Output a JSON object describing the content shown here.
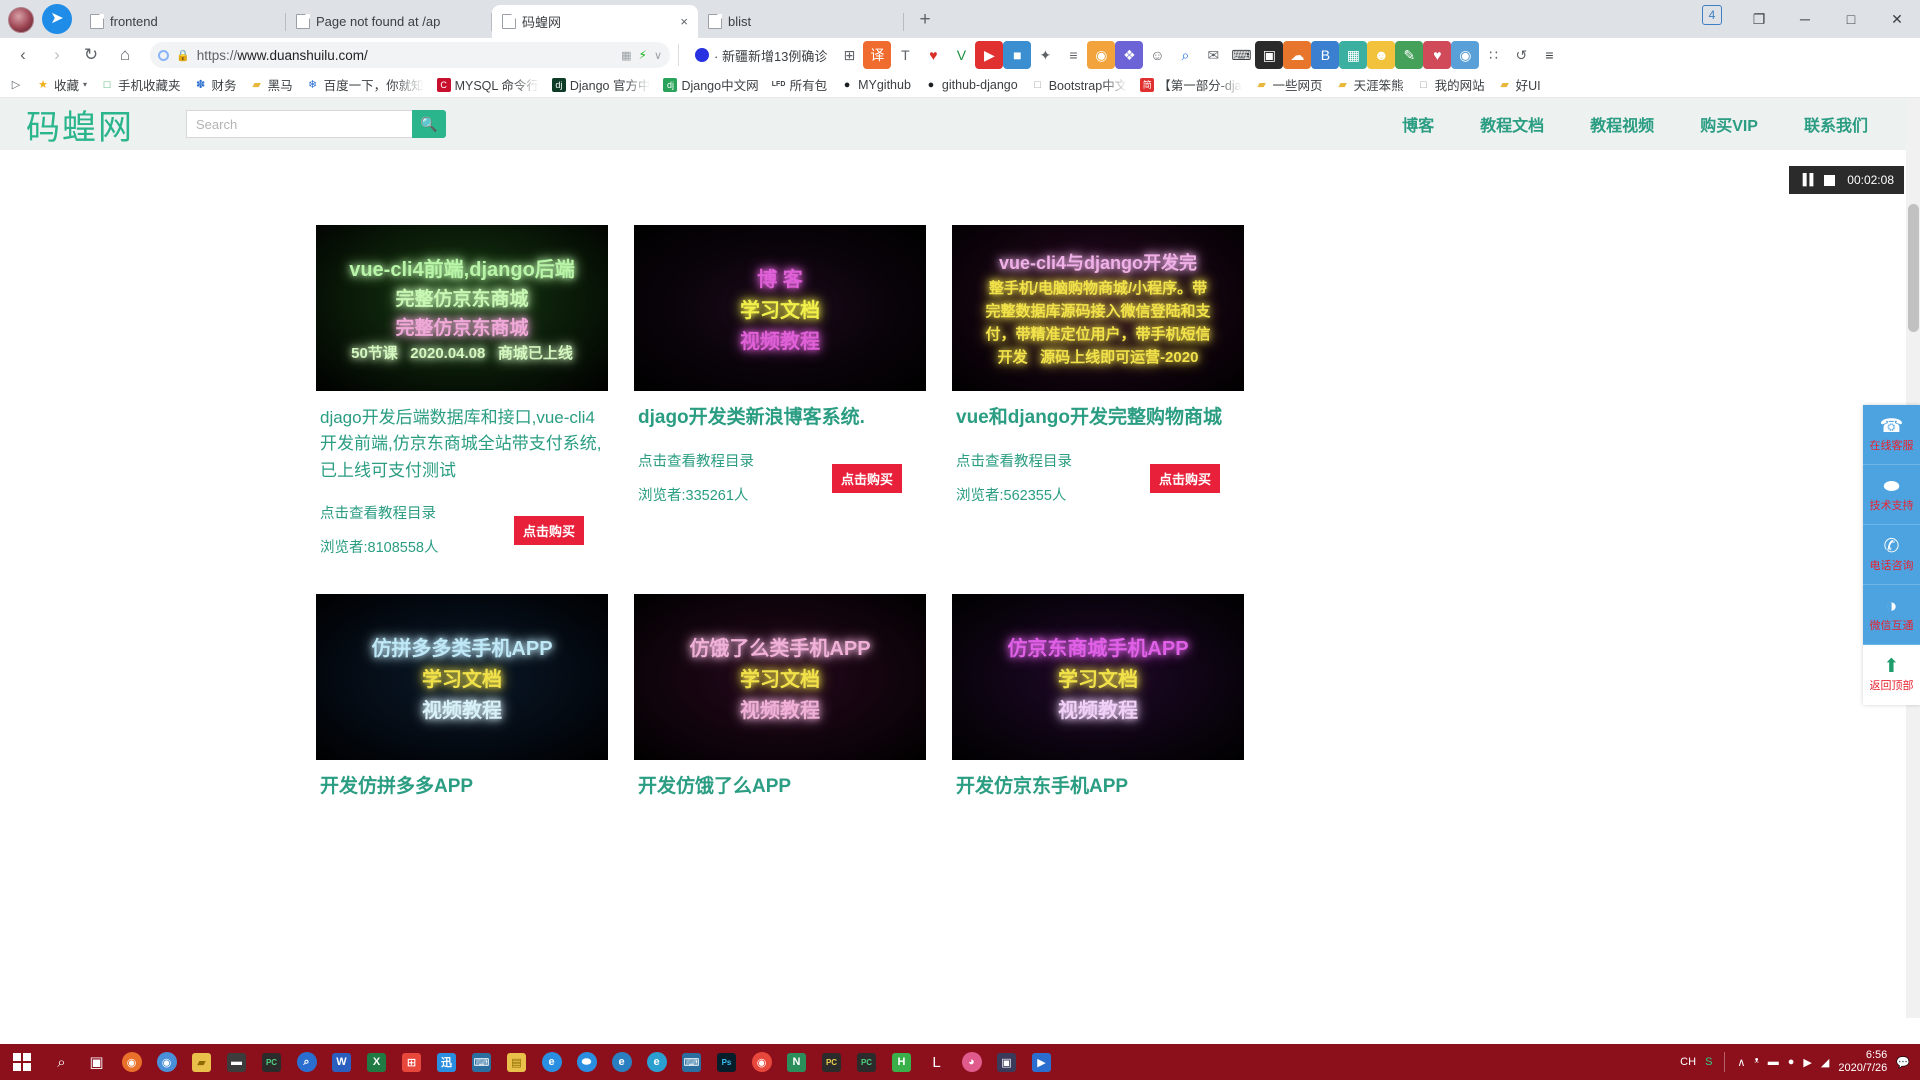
{
  "browser": {
    "tabs": [
      {
        "title": "frontend",
        "active": false,
        "closable": false
      },
      {
        "title": "Page not found at /ap",
        "active": false,
        "closable": false
      },
      {
        "title": "码蝗网",
        "active": true,
        "closable": true,
        "close_label": "×"
      },
      {
        "title": "blist",
        "active": false,
        "closable": false
      }
    ],
    "newtab_label": "+",
    "window_controls": {
      "tab_count": "4",
      "restore": "❐",
      "minimize": "─",
      "maximize": "□",
      "close": "✕"
    },
    "nav": {
      "back": "‹",
      "forward": "›",
      "reload": "↻",
      "home": "⌂"
    },
    "omnibox": {
      "url_prefix": "https://",
      "url_main": "www.duanshuilu.com/",
      "lock_icon": "lock-icon",
      "qr_icon": "qr-icon",
      "bolt_icon": "bolt-icon",
      "chevron": "∨"
    },
    "news_item": {
      "text": "· 新疆新增13例确诊",
      "icon": "baidu-icon"
    },
    "extensions": [
      {
        "name": "grid-icon",
        "glyph": "⊞",
        "color": "#5f6368",
        "bg": "transparent"
      },
      {
        "name": "translate-icon",
        "glyph": "译",
        "color": "#ffffff",
        "bg": "#f06c2e"
      },
      {
        "name": "text-format-icon",
        "glyph": "T",
        "color": "#5f6368",
        "bg": "transparent"
      },
      {
        "name": "shield-icon",
        "glyph": "♥",
        "color": "#d93025",
        "bg": "transparent"
      },
      {
        "name": "v-icon",
        "glyph": "V",
        "color": "#1a8f3c",
        "bg": "transparent"
      },
      {
        "name": "youtube-icon",
        "glyph": "▶",
        "color": "#ffffff",
        "bg": "#e03030"
      },
      {
        "name": "folder-icon",
        "glyph": "■",
        "color": "#ffffff",
        "bg": "#3b8ed0"
      },
      {
        "name": "star-tool-icon",
        "glyph": "✦",
        "color": "#5f6368",
        "bg": "transparent"
      },
      {
        "name": "menu-icon",
        "glyph": "≡",
        "color": "#5f6368",
        "bg": "transparent"
      },
      {
        "name": "chrome-ext-icon",
        "glyph": "◉",
        "color": "#ffffff",
        "bg": "#f2a33c"
      },
      {
        "name": "gamepad-icon",
        "glyph": "❖",
        "color": "#ffffff",
        "bg": "#6b63d6"
      },
      {
        "name": "avatar-icon",
        "glyph": "☺",
        "color": "#5f6368",
        "bg": "transparent"
      },
      {
        "name": "search-icon",
        "glyph": "⌕",
        "color": "#1a73e8",
        "bg": "transparent"
      },
      {
        "name": "mail-icon",
        "glyph": "✉",
        "color": "#5f6368",
        "bg": "transparent"
      },
      {
        "name": "keyboard-icon",
        "glyph": "⌨",
        "color": "#3c4043",
        "bg": "transparent"
      },
      {
        "name": "monitor-icon",
        "glyph": "▣",
        "color": "#ffffff",
        "bg": "#2a2a2a"
      },
      {
        "name": "cloud-icon",
        "glyph": "☁",
        "color": "#ffffff",
        "bg": "#e8752c"
      },
      {
        "name": "bookmark-b-icon",
        "glyph": "B",
        "color": "#ffffff",
        "bg": "#3b7fd0"
      },
      {
        "name": "calendar-icon",
        "glyph": "▦",
        "color": "#ffffff",
        "bg": "#3bb0a0"
      },
      {
        "name": "smile-icon",
        "glyph": "☻",
        "color": "#ffffff",
        "bg": "#f2c23c"
      },
      {
        "name": "pen-icon",
        "glyph": "✎",
        "color": "#ffffff",
        "bg": "#45a05a"
      },
      {
        "name": "heart-icon",
        "glyph": "♥",
        "color": "#ffffff",
        "bg": "#d14a5a"
      },
      {
        "name": "camera-icon",
        "glyph": "◉",
        "color": "#ffffff",
        "bg": "#5aa0d8"
      },
      {
        "name": "apps-icon",
        "glyph": "∷",
        "color": "#5f6368",
        "bg": "transparent"
      },
      {
        "name": "history-icon",
        "glyph": "↺",
        "color": "#5f6368",
        "bg": "transparent"
      },
      {
        "name": "more-icon",
        "glyph": "≡",
        "color": "#3c4043",
        "bg": "transparent"
      }
    ],
    "bookmarks": [
      {
        "label": "",
        "icon": "▷",
        "icon_color": "#5f6368",
        "icon_bg": "transparent"
      },
      {
        "label": "收藏",
        "icon": "★",
        "icon_color": "#f2b01e",
        "icon_bg": "transparent",
        "caret": "▾"
      },
      {
        "label": "手机收藏夹",
        "icon": "□",
        "icon_color": "#3bb06a",
        "icon_bg": "transparent"
      },
      {
        "label": "财务",
        "icon": "✽",
        "icon_color": "#2a6fd0",
        "icon_bg": "transparent"
      },
      {
        "label": "黑马",
        "icon": "▰",
        "icon_color": "#e8b83c",
        "icon_bg": "transparent"
      },
      {
        "label": "百度一下，你就知",
        "icon": "❄",
        "icon_color": "#2a6fd0",
        "icon_bg": "transparent",
        "fade": true
      },
      {
        "label": "MYSQL 命令行",
        "icon": "C",
        "icon_color": "#ffffff",
        "icon_bg": "#c8102e",
        "fade": true
      },
      {
        "label": "Django 官方中",
        "icon": "dj",
        "icon_color": "#ffffff",
        "icon_bg": "#0c3c26",
        "fade": true
      },
      {
        "label": "Django中文网",
        "icon": "dj",
        "icon_color": "#ffffff",
        "icon_bg": "#2aa35a"
      },
      {
        "label": "所有包",
        "icon": "LFD",
        "icon_color": "#3c4043",
        "icon_bg": "transparent"
      },
      {
        "label": "MYgithub",
        "icon": "●",
        "icon_color": "#1b1f23",
        "icon_bg": "transparent"
      },
      {
        "label": "github-django",
        "icon": "●",
        "icon_color": "#1b1f23",
        "icon_bg": "transparent"
      },
      {
        "label": "Bootstrap中文",
        "icon": "□",
        "icon_color": "#9aa0a6",
        "icon_bg": "transparent",
        "fade": true
      },
      {
        "label": "【第一部分-dja",
        "icon": "简",
        "icon_color": "#ffffff",
        "icon_bg": "#e03030",
        "fade": true
      },
      {
        "label": "一些网页",
        "icon": "▰",
        "icon_color": "#e8b83c",
        "icon_bg": "transparent"
      },
      {
        "label": "天涯笨熊",
        "icon": "▰",
        "icon_color": "#e8b83c",
        "icon_bg": "transparent"
      },
      {
        "label": "我的网站",
        "icon": "□",
        "icon_color": "#9aa0a6",
        "icon_bg": "transparent"
      },
      {
        "label": "好UI",
        "icon": "▰",
        "icon_color": "#e8b83c",
        "icon_bg": "transparent"
      }
    ]
  },
  "site": {
    "logo": "码蝗网",
    "search": {
      "placeholder": "Search",
      "value": "",
      "button_icon": "search-icon"
    },
    "nav": [
      {
        "label": "博客",
        "active": true
      },
      {
        "label": "教程文档",
        "active": false
      },
      {
        "label": "教程视频",
        "active": false
      },
      {
        "label": "购买VIP",
        "active": false
      },
      {
        "label": "联系我们",
        "active": false
      }
    ],
    "accent": "#2a9d82",
    "recorder": {
      "pause_icon": "pause-icon",
      "stop_icon": "stop-icon",
      "time": "00:02:08"
    },
    "cards": [
      {
        "banner_lines": [
          {
            "text": "vue-cli4前端,django后端",
            "color": "#b9f5a8",
            "size": 20
          },
          {
            "text": "完整仿京东商城",
            "color": "#c8f7b4",
            "size": 19
          },
          {
            "text": "完整仿京东商城",
            "color": "#f0a8d8",
            "size": 19
          },
          {
            "text": "50节课   2020.04.08   商城已上线",
            "color": "#d4f7c0",
            "size": 15
          }
        ],
        "banner_bg": "radial-gradient(ellipse at 50% 45%, #163a12 0%, #0a1a08 55%, #000 100%)",
        "title": "djago开发后端数据库和接口,vue-cli4开发前端,仿京东商城全站带支付系统,已上线可支付测试",
        "title_thin": true,
        "catalog_link": "点击查看教程目录",
        "viewers": "浏览者:8108558人",
        "buy_label": "点击购买",
        "has_buy": true
      },
      {
        "banner_lines": [
          {
            "text": "博 客",
            "color": "#e060d8",
            "size": 20
          },
          {
            "text": "学习文档",
            "color": "#f2f04a",
            "size": 20
          },
          {
            "text": "视频教程",
            "color": "#e060d8",
            "size": 20
          }
        ],
        "banner_bg": "radial-gradient(ellipse at 50% 50%, #1a0a1a 0%, #080308 60%, #000 100%)",
        "title": "djago开发类新浪博客系统.",
        "title_thin": false,
        "catalog_link": "点击查看教程目录",
        "viewers": "浏览者:335261人",
        "buy_label": "点击购买",
        "has_buy": true
      },
      {
        "banner_lines": [
          {
            "text": "vue-cli4与django开发完",
            "color": "#f0b0e8",
            "size": 18
          },
          {
            "text": "整手机/电脑购物商城/小程序。带",
            "color": "#f2e24a",
            "size": 15
          },
          {
            "text": "完整数据库源码接入微信登陆和支",
            "color": "#f2e24a",
            "size": 15
          },
          {
            "text": "付，带精准定位用户，带手机短信",
            "color": "#f2e24a",
            "size": 15
          },
          {
            "text": "开发   源码上线即可运营-2020",
            "color": "#f2e24a",
            "size": 15
          }
        ],
        "banner_bg": "radial-gradient(ellipse at 50% 45%, #2a0a24 0%, #12040f 55%, #000 100%)",
        "title": "vue和django开发完整购物商城",
        "title_thin": false,
        "catalog_link": "点击查看教程目录",
        "viewers": "浏览者:562355人",
        "buy_label": "点击购买",
        "has_buy": true
      },
      {
        "banner_lines": [
          {
            "text": "仿拼多多类手机APP",
            "color": "#bfe8f7",
            "size": 20
          },
          {
            "text": "学习文档",
            "color": "#f2e24a",
            "size": 20
          },
          {
            "text": "视频教程",
            "color": "#d8f0f7",
            "size": 20
          }
        ],
        "banner_bg": "radial-gradient(ellipse at 50% 50%, #0a1828 0%, #040a12 60%, #000 100%)",
        "title": "开发仿拼多多APP",
        "title_thin": false,
        "catalog_link": "",
        "viewers": "",
        "buy_label": "",
        "has_buy": false
      },
      {
        "banner_lines": [
          {
            "text": "仿饿了么类手机APP",
            "color": "#f0b0d8",
            "size": 20
          },
          {
            "text": "学习文档",
            "color": "#f2e24a",
            "size": 20
          },
          {
            "text": "视频教程",
            "color": "#f0b0d8",
            "size": 20
          }
        ],
        "banner_bg": "radial-gradient(ellipse at 50% 50%, #24081c 0%, #10040c 60%, #000 100%)",
        "title": "开发仿饿了么APP",
        "title_thin": false,
        "catalog_link": "",
        "viewers": "",
        "buy_label": "",
        "has_buy": false
      },
      {
        "banner_lines": [
          {
            "text": "仿京东商城手机APP",
            "color": "#e060e8",
            "size": 20
          },
          {
            "text": "学习文档",
            "color": "#f2e24a",
            "size": 20
          },
          {
            "text": "视频教程",
            "color": "#f0d0f7",
            "size": 20
          }
        ],
        "banner_bg": "radial-gradient(ellipse at 50% 50%, #20082a 0%, #0c0410 60%, #000 100%)",
        "title": "开发仿京东手机APP",
        "title_thin": false,
        "catalog_link": "",
        "viewers": "",
        "buy_label": "",
        "has_buy": false
      }
    ],
    "side_widget": [
      {
        "icon": "headset-icon",
        "glyph": "☎",
        "label": "在线客服"
      },
      {
        "icon": "qq-penguin-icon",
        "glyph": "⬬",
        "label": "技术支持"
      },
      {
        "icon": "phone-icon",
        "glyph": "✆",
        "label": "电话咨询"
      },
      {
        "icon": "wechat-icon",
        "glyph": "◑",
        "label": "微信互通"
      },
      {
        "icon": "back-to-top-icon",
        "glyph": "⬆",
        "label": "返回顶部"
      }
    ]
  },
  "taskbar": {
    "start_icon": "windows-start-icon",
    "items": [
      {
        "name": "search-icon",
        "glyph": "⌕",
        "bg": "transparent",
        "color": "#ffffff",
        "shape": "plain"
      },
      {
        "name": "task-view-icon",
        "glyph": "▣",
        "bg": "transparent",
        "color": "#ffffff",
        "shape": "plain"
      },
      {
        "name": "firefox-icon",
        "glyph": "◉",
        "bg": "#e8702a",
        "color": "#ffffff",
        "shape": "circle"
      },
      {
        "name": "chrome-icon",
        "glyph": "◉",
        "bg": "#4a90d9",
        "color": "#ffffff",
        "shape": "circle"
      },
      {
        "name": "folder-icon",
        "glyph": "▰",
        "bg": "#e8c04a",
        "color": "#8c6a00",
        "shape": "square"
      },
      {
        "name": "terminal-icon",
        "glyph": "▬",
        "bg": "#3c3c3c",
        "color": "#ffffff",
        "shape": "square"
      },
      {
        "name": "pycharm-icon",
        "glyph": "PC",
        "bg": "#2b2b2b",
        "color": "#50d080",
        "shape": "square"
      },
      {
        "name": "search2-icon",
        "glyph": "⌕",
        "bg": "#2a6fd0",
        "color": "#ffffff",
        "shape": "circle"
      },
      {
        "name": "word-icon",
        "glyph": "W",
        "bg": "#2a5fc0",
        "color": "#ffffff",
        "shape": "square"
      },
      {
        "name": "excel-icon",
        "glyph": "X",
        "bg": "#1f7a44",
        "color": "#ffffff",
        "shape": "square"
      },
      {
        "name": "store-icon",
        "glyph": "⊞",
        "bg": "#e8483c",
        "color": "#ffffff",
        "shape": "square"
      },
      {
        "name": "xunlei-icon",
        "glyph": "迅",
        "bg": "#2a8fe0",
        "color": "#ffffff",
        "shape": "square"
      },
      {
        "name": "vscode-icon",
        "glyph": "⌨",
        "bg": "#2a6fa0",
        "color": "#ffffff",
        "shape": "square"
      },
      {
        "name": "note-icon",
        "glyph": "▤",
        "bg": "#e8c04a",
        "color": "#8c6a00",
        "shape": "square"
      },
      {
        "name": "ie-icon",
        "glyph": "e",
        "bg": "#2a8fe0",
        "color": "#ffffff",
        "shape": "circle"
      },
      {
        "name": "qq-icon",
        "glyph": "⬬",
        "bg": "#2a8fe0",
        "color": "#ffffff",
        "shape": "circle"
      },
      {
        "name": "edge-icon",
        "glyph": "e",
        "bg": "#2a7fc0",
        "color": "#ffffff",
        "shape": "circle"
      },
      {
        "name": "edge2-icon",
        "glyph": "e",
        "bg": "#2a9fd0",
        "color": "#ffffff",
        "shape": "circle"
      },
      {
        "name": "vscode2-icon",
        "glyph": "⌨",
        "bg": "#2a6fa0",
        "color": "#ffffff",
        "shape": "square"
      },
      {
        "name": "photoshop-icon",
        "glyph": "Ps",
        "bg": "#061e2a",
        "color": "#3ac0f0",
        "shape": "square"
      },
      {
        "name": "chrome2-icon",
        "glyph": "◉",
        "bg": "#e8483c",
        "color": "#ffffff",
        "shape": "circle"
      },
      {
        "name": "navicat-icon",
        "glyph": "N",
        "bg": "#2a8f5a",
        "color": "#ffffff",
        "shape": "square"
      },
      {
        "name": "pycharm2-icon",
        "glyph": "PC",
        "bg": "#2b2b2b",
        "color": "#f0d050",
        "shape": "square"
      },
      {
        "name": "pycharm3-icon",
        "glyph": "PC",
        "bg": "#2b2b2b",
        "color": "#50d080",
        "shape": "square"
      },
      {
        "name": "hbuilder-icon",
        "glyph": "H",
        "bg": "#3ab04a",
        "color": "#ffffff",
        "shape": "square"
      },
      {
        "name": "settings-icon",
        "glyph": "L",
        "bg": "transparent",
        "color": "#ffffff",
        "shape": "plain"
      },
      {
        "name": "color-icon",
        "glyph": "◕",
        "bg": "#e05a8c",
        "color": "#ffffff",
        "shape": "circle"
      },
      {
        "name": "camera2-icon",
        "glyph": "▣",
        "bg": "#3a3a5a",
        "color": "#ffffff",
        "shape": "square"
      },
      {
        "name": "player-icon",
        "glyph": "▶",
        "bg": "#2a6fd0",
        "color": "#ffffff",
        "shape": "square"
      }
    ],
    "ime": {
      "lang": "CH",
      "mode": "S"
    },
    "tray": [
      {
        "name": "chevron-up-icon",
        "glyph": "∧"
      },
      {
        "name": "mic-icon",
        "glyph": "ᵜ"
      },
      {
        "name": "battery-icon",
        "glyph": "▬"
      },
      {
        "name": "shield-tray-icon",
        "glyph": "●"
      },
      {
        "name": "volume-icon",
        "glyph": "▶"
      },
      {
        "name": "network-icon",
        "glyph": "◢"
      }
    ],
    "clock": {
      "time": "6:56",
      "date": "2020/7/26"
    },
    "notification_icon": "notification-icon",
    "accent": "#8c0f1c"
  }
}
